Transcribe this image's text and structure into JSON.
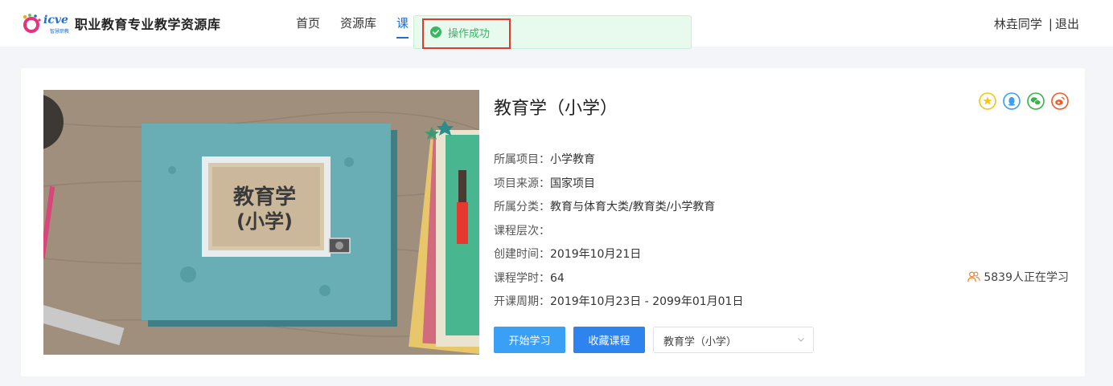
{
  "header": {
    "logo_brand": "icve",
    "logo_sub": "智慧职教",
    "site_title": "职业教育专业教学资源库",
    "nav": [
      {
        "label": "首页",
        "active": false
      },
      {
        "label": "资源库",
        "active": false
      },
      {
        "label": "课",
        "active": true
      }
    ],
    "user_name": "林垚同学",
    "separator": "|",
    "logout_label": "退出"
  },
  "toast": {
    "message": "操作成功",
    "icon": "check-circle-icon",
    "color": "#35b85f"
  },
  "course": {
    "cover_title_line1": "教育学",
    "cover_title_line2": "(小学)",
    "title": "教育学（小学）",
    "share_icons": [
      "star-icon",
      "qq-icon",
      "wechat-icon",
      "weibo-icon"
    ],
    "meta": [
      {
        "label": "所属项目：",
        "value": "小学教育"
      },
      {
        "label": "项目来源：",
        "value": "国家项目"
      },
      {
        "label": "所属分类：",
        "value": "教育与体育大类/教育类/小学教育"
      },
      {
        "label": "课程层次：",
        "value": ""
      },
      {
        "label": "创建时间：",
        "value": "2019年10月21日"
      },
      {
        "label": "课程学时：",
        "value": "64"
      },
      {
        "label": "开课周期：",
        "value": "2019年10月23日 - 2099年01月01日"
      }
    ],
    "learners_text": "5839人正在学习",
    "start_label": "开始学习",
    "favorite_label": "收藏课程",
    "select_value": "教育学（小学）"
  },
  "colors": {
    "accent": "#2f83ee",
    "start_button": "#3aa0f5",
    "highlight_box": "#e03a2f"
  }
}
